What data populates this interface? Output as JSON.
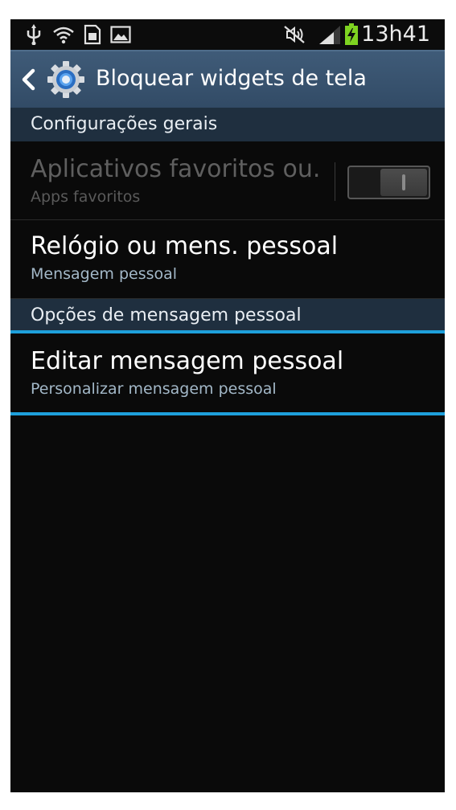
{
  "status_bar": {
    "time": "13h41",
    "left_icons": [
      "usb-icon",
      "wifi-question-icon",
      "sim-card-icon",
      "image-icon"
    ],
    "right_icons": [
      "mute-icon",
      "signal-icon",
      "battery-charging-icon"
    ]
  },
  "action_bar": {
    "title": "Bloquear widgets de tela"
  },
  "sections": {
    "general": {
      "label": "Configurações gerais"
    },
    "personal_message_options": {
      "label": "Opções de mensagem pessoal"
    }
  },
  "items": {
    "favorite_apps": {
      "title": "Aplicativos favoritos ou.",
      "subtitle": "Apps favoritos",
      "enabled": false
    },
    "clock_or_message": {
      "title": "Relógio ou mens. pessoal",
      "subtitle": "Mensagem pessoal"
    },
    "edit_message": {
      "title": "Editar mensagem pessoal",
      "subtitle": "Personalizar mensagem pessoal"
    }
  },
  "colors": {
    "action_bar": "#3a5470",
    "section_header": "#1f2f3f",
    "highlight": "#1ea0dc",
    "subtitle": "#a3b8c8",
    "battery": "#7ed321"
  }
}
